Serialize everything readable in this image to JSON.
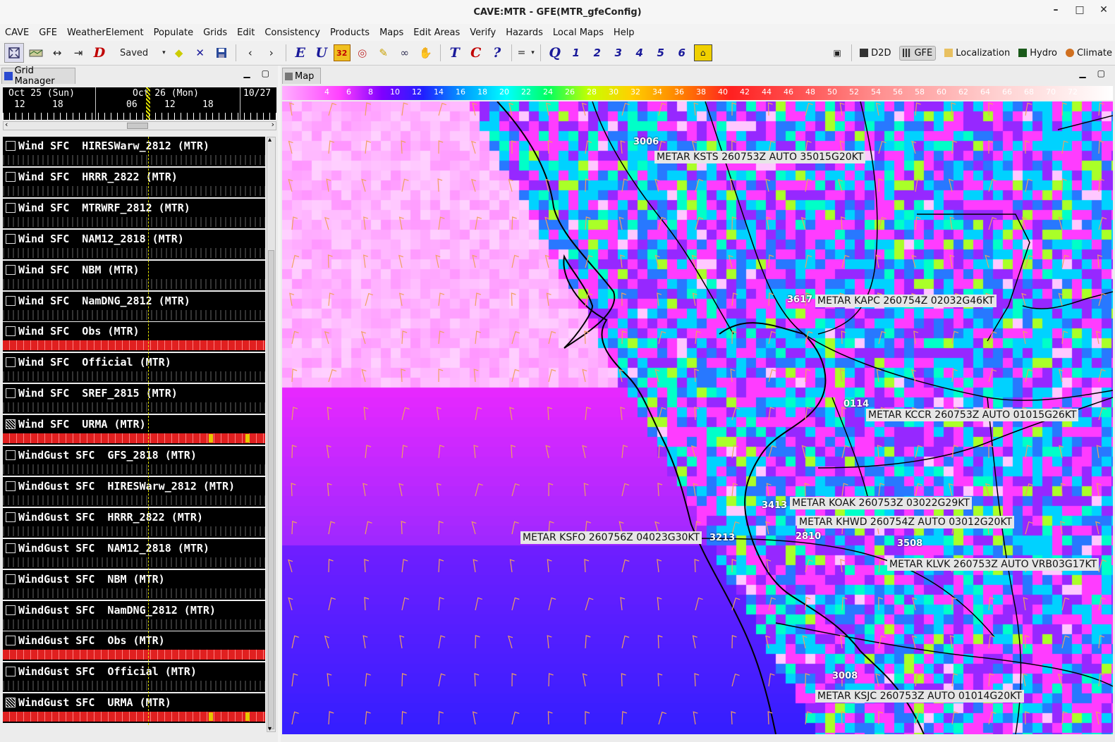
{
  "window": {
    "title": "CAVE:MTR - GFE(MTR_gfeConfig)",
    "controls": [
      "–",
      "□",
      "✕"
    ]
  },
  "menu": [
    "CAVE",
    "GFE",
    "WeatherElement",
    "Populate",
    "Grids",
    "Edit",
    "Consistency",
    "Products",
    "Maps",
    "Edit Areas",
    "Verify",
    "Hazards",
    "Local Maps",
    "Help"
  ],
  "toolbar": {
    "saved_label": "Saved",
    "badge_value": "32",
    "edit_letters": [
      "E",
      "U"
    ],
    "text_letters": [
      "T",
      "C",
      "?"
    ],
    "equals": "=",
    "q_letter": "Q",
    "numbers": [
      "1",
      "2",
      "3",
      "4",
      "5",
      "6"
    ],
    "d_letter": "D",
    "perspectives": [
      "D2D",
      "GFE",
      "Localization",
      "Hydro",
      "Climate"
    ]
  },
  "grid_manager": {
    "tab": "Grid Manager",
    "time_labels": {
      "day1": "Oct 25 (Sun)",
      "day2": "Oct 26 (Mon)",
      "day3": "10/27"
    },
    "hours": [
      "12",
      "18",
      "06",
      "12",
      "18"
    ],
    "rows": [
      {
        "name": "Wind SFC  HIRESWarw_2812 (MTR)",
        "strip": "grey"
      },
      {
        "name": "Wind SFC  HRRR_2822 (MTR)",
        "strip": "grey"
      },
      {
        "name": "Wind SFC  MTRWRF_2812 (MTR)",
        "strip": "grey"
      },
      {
        "name": "Wind SFC  NAM12_2818 (MTR)",
        "strip": "grey"
      },
      {
        "name": "Wind SFC  NBM (MTR)",
        "strip": "grey"
      },
      {
        "name": "Wind SFC  NamDNG_2812 (MTR)",
        "strip": "grey"
      },
      {
        "name": "Wind SFC  Obs (MTR)",
        "strip": "red"
      },
      {
        "name": "Wind SFC  Official (MTR)",
        "strip": "grey"
      },
      {
        "name": "Wind SFC  SREF_2815 (MTR)",
        "strip": "grey"
      },
      {
        "name": "Wind SFC  URMA (MTR)",
        "strip": "red-marked"
      },
      {
        "name": "WindGust SFC  GFS_2818 (MTR)",
        "strip": "grey"
      },
      {
        "name": "WindGust SFC  HIRESWarw_2812 (MTR)",
        "strip": "grey"
      },
      {
        "name": "WindGust SFC  HRRR_2822 (MTR)",
        "strip": "grey"
      },
      {
        "name": "WindGust SFC  NAM12_2818 (MTR)",
        "strip": "grey"
      },
      {
        "name": "WindGust SFC  NBM (MTR)",
        "strip": "grey"
      },
      {
        "name": "WindGust SFC  NamDNG_2812 (MTR)",
        "strip": "grey"
      },
      {
        "name": "WindGust SFC  Obs (MTR)",
        "strip": "red"
      },
      {
        "name": "WindGust SFC  Official (MTR)",
        "strip": "grey"
      },
      {
        "name": "WindGust SFC  URMA (MTR)",
        "strip": "red-marked"
      }
    ]
  },
  "map": {
    "tab": "Map",
    "colorbar_labels": [
      "4",
      "6",
      "8",
      "10",
      "12",
      "14",
      "16",
      "18",
      "20",
      "22",
      "24",
      "26",
      "28",
      "30",
      "32",
      "34",
      "36",
      "38",
      "40",
      "42",
      "44",
      "46",
      "48",
      "50",
      "52",
      "54",
      "56",
      "58",
      "60",
      "62",
      "64",
      "66",
      "68",
      "70",
      "72"
    ],
    "metars": [
      "METAR KSTS 260753Z AUTO 35015G20KT",
      "METAR KAPC 260754Z 02032G46KT",
      "METAR KCCR 260753Z AUTO 01015G26KT",
      "METAR KOAK 260753Z 03022G29KT",
      "METAR KHWD 260754Z AUTO 03012G20KT",
      "METAR KSFO 260756Z 04023G30KT",
      "METAR KLVK 260753Z AUTO VRB03G17KT",
      "METAR KSJC 260753Z AUTO 01014G20KT"
    ],
    "stations": [
      "3006",
      "3617",
      "0114",
      "3413",
      "3213",
      "2810",
      "3508",
      "3008"
    ]
  },
  "colors": {
    "accent": "#1a1a9a",
    "strip_red": "#e02020",
    "marker_yellow": "#e6c800"
  }
}
